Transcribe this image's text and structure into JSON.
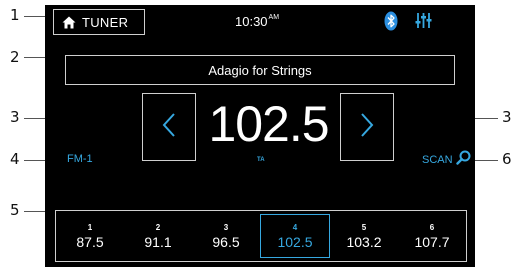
{
  "callouts": {
    "c1": "1",
    "c2": "2",
    "c3_left": "3",
    "c3_right": "3",
    "c4": "4",
    "c5": "5",
    "c6": "6"
  },
  "status_bar": {
    "source_label": "TUNER",
    "source_icon": "home-icon",
    "time": "10:30",
    "ampm": "AM",
    "bluetooth_icon": "bluetooth-icon",
    "settings_icon": "equalizer-settings-icon"
  },
  "now_playing": {
    "title": "Adagio for Strings"
  },
  "tuner": {
    "frequency": "102.5",
    "ta_label": "TA",
    "prev_icon": "chevron-left-icon",
    "next_icon": "chevron-right-icon",
    "band": "FM-1",
    "scan_label": "SCAN",
    "scan_icon": "search-icon"
  },
  "presets": [
    {
      "number": "1",
      "frequency": "87.5",
      "active": false
    },
    {
      "number": "2",
      "frequency": "91.1",
      "active": false
    },
    {
      "number": "3",
      "frequency": "96.5",
      "active": false
    },
    {
      "number": "4",
      "frequency": "102.5",
      "active": true
    },
    {
      "number": "5",
      "frequency": "103.2",
      "active": false
    },
    {
      "number": "6",
      "frequency": "107.7",
      "active": false
    }
  ],
  "colors": {
    "accent": "#36a8e0",
    "background": "#000000",
    "border": "#cfcfcf",
    "text": "#ffffff"
  }
}
